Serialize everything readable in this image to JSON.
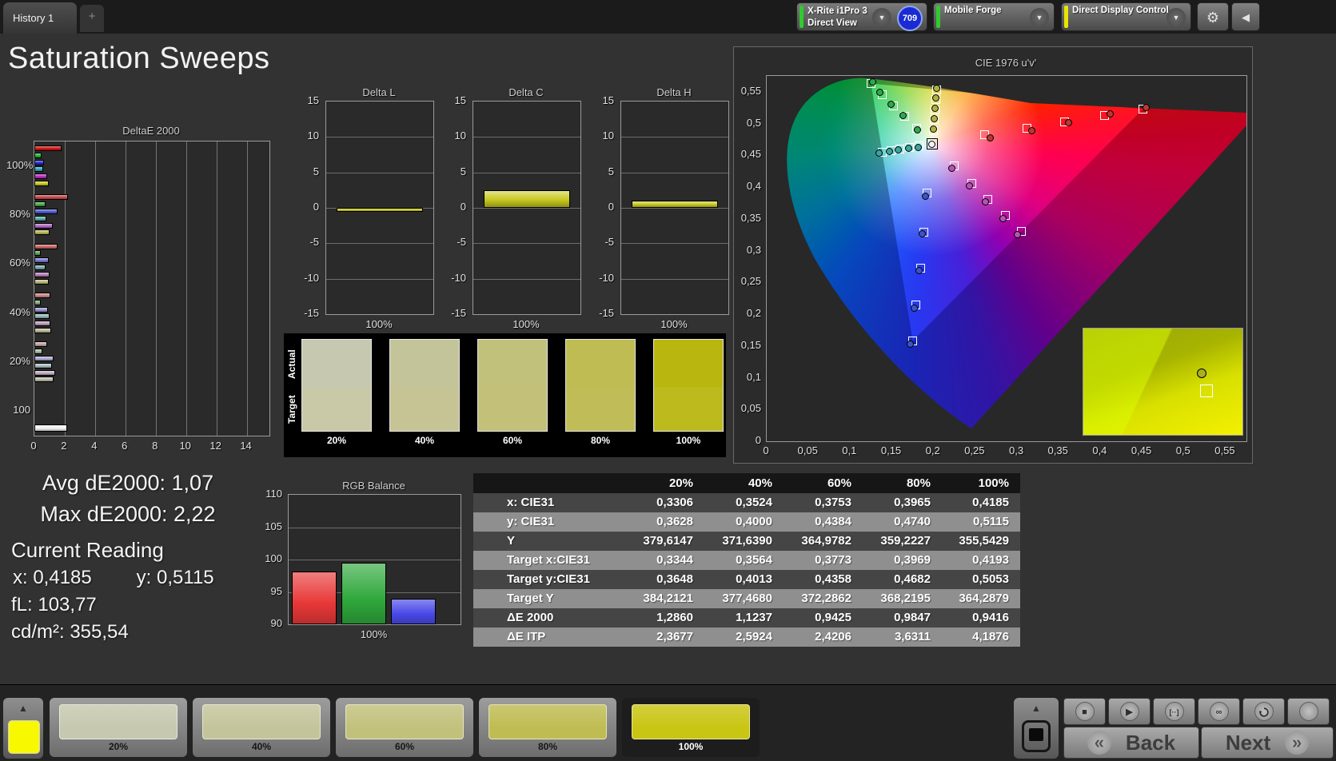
{
  "topbar": {
    "tab": "History 1",
    "add_tab": "+",
    "meter": {
      "line1": "X-Rite i1Pro 3",
      "line2": "Direct View",
      "stripe": "#2ecc2e"
    },
    "badge": "709",
    "source": {
      "label": "Mobile Forge",
      "stripe": "#2ecc2e"
    },
    "display": {
      "label": "Direct Display Control",
      "stripe": "#e6e600"
    },
    "gear_icon": "⚙",
    "collapse_icon": "◀",
    "chevron_icon": "▼"
  },
  "page": {
    "title": "Saturation Sweeps"
  },
  "stats": {
    "avg": "Avg dE2000: 1,07",
    "max": "Max dE2000: 2,22",
    "current_reading": "Current Reading",
    "x": "x: 0,4185",
    "y": "y: 0,5115",
    "fl": "fL: 103,77",
    "cdm2": "cd/m²: 355,54"
  },
  "chart_data": [
    {
      "id": "deltae2000",
      "type": "bar",
      "orientation": "horizontal",
      "title": "DeltaE 2000",
      "xlim": [
        0,
        15.5
      ],
      "xticks": [
        0,
        2,
        4,
        6,
        8,
        10,
        12,
        14
      ],
      "groups": [
        {
          "label": "100%",
          "values": [
            1.8,
            0.5,
            0.65,
            0.6,
            0.85,
            0.94
          ],
          "colors": [
            "#d41414",
            "#18b830",
            "#2828dd",
            "#28a8c8",
            "#c02cc0",
            "#c8c81e"
          ]
        },
        {
          "label": "80%",
          "values": [
            2.22,
            0.72,
            1.55,
            0.78,
            1.2,
            0.98
          ],
          "colors": [
            "#c84848",
            "#44aa44",
            "#4c5ad0",
            "#55aaaa",
            "#b368c4",
            "#b9b95a"
          ]
        },
        {
          "label": "60%",
          "values": [
            1.55,
            0.4,
            0.95,
            0.75,
            1.0,
            0.94
          ],
          "colors": [
            "#c86464",
            "#58a858",
            "#7878d0",
            "#74a8a8",
            "#b87cb8",
            "#b8b878"
          ]
        },
        {
          "label": "40%",
          "values": [
            1.05,
            0.42,
            0.9,
            1.0,
            1.05,
            1.12
          ],
          "colors": [
            "#c88484",
            "#84ac7c",
            "#9494d0",
            "#94b4b4",
            "#bc9cbc",
            "#b8b894"
          ]
        },
        {
          "label": "20%",
          "values": [
            0.85,
            0.55,
            1.28,
            1.15,
            1.35,
            1.29
          ],
          "colors": [
            "#c4a4a4",
            "#a4bca0",
            "#a8a8d4",
            "#a8bcbc",
            "#c0acc0",
            "#bcbca8"
          ]
        },
        {
          "label": "100",
          "values": [
            2.17
          ],
          "colors": [
            "#f0f0f0"
          ]
        }
      ]
    },
    {
      "id": "delta_l",
      "type": "bar",
      "title": "Delta L",
      "ylim": [
        -15,
        15
      ],
      "yticks": [
        15,
        10,
        5,
        0,
        -5,
        -10,
        -15
      ],
      "categories": [
        "100%"
      ],
      "values": [
        -0.6
      ],
      "bar_color": "#c8c81e"
    },
    {
      "id": "delta_c",
      "type": "bar",
      "title": "Delta C",
      "ylim": [
        -15,
        15
      ],
      "yticks": [
        15,
        10,
        5,
        0,
        -5,
        -10,
        -15
      ],
      "categories": [
        "100%"
      ],
      "values": [
        2.5
      ],
      "bar_color": "#c8c81e"
    },
    {
      "id": "delta_h",
      "type": "bar",
      "title": "Delta H",
      "ylim": [
        -15,
        15
      ],
      "yticks": [
        15,
        10,
        5,
        0,
        -5,
        -10,
        -15
      ],
      "categories": [
        "100%"
      ],
      "values": [
        1.0
      ],
      "bar_color": "#c8c81e"
    },
    {
      "id": "cie",
      "type": "scatter",
      "title": "CIE 1976 u'v'",
      "xlim": [
        0,
        0.575
      ],
      "ylim": [
        0,
        0.575
      ],
      "xticks": [
        0,
        0.05,
        0.1,
        0.15,
        0.2,
        0.25,
        0.3,
        0.35,
        0.4,
        0.45,
        0.5,
        0.55
      ],
      "xtick_labels": [
        "0",
        "0,05",
        "0,1",
        "0,15",
        "0,2",
        "0,25",
        "0,3",
        "0,35",
        "0,4",
        "0,45",
        "0,5",
        "0,55"
      ],
      "ytick_labels": [
        "0,55",
        "0,5",
        "0,45",
        "0,4",
        "0,35",
        "0,3",
        "0,25",
        "0,2",
        "0,15",
        "0,1",
        "0,05",
        "0"
      ],
      "yticks": [
        0.55,
        0.5,
        0.45,
        0.4,
        0.35,
        0.3,
        0.25,
        0.2,
        0.15,
        0.1,
        0.05,
        0
      ],
      "white_point": {
        "u": 0.198,
        "v": 0.468
      },
      "series": [
        {
          "name": "red",
          "color": "#b73a32",
          "targets": [
            [
              0.261,
              0.482
            ],
            [
              0.312,
              0.493
            ],
            [
              0.357,
              0.503
            ],
            [
              0.405,
              0.513
            ],
            [
              0.451,
              0.523
            ]
          ],
          "measured": [
            [
              0.268,
              0.478
            ],
            [
              0.318,
              0.489
            ],
            [
              0.362,
              0.501
            ],
            [
              0.412,
              0.515
            ],
            [
              0.455,
              0.525
            ]
          ]
        },
        {
          "name": "green",
          "color": "#2ea84e",
          "targets": [
            [
              0.18,
              0.492
            ],
            [
              0.165,
              0.511
            ],
            [
              0.152,
              0.528
            ],
            [
              0.138,
              0.546
            ],
            [
              0.125,
              0.563
            ]
          ],
          "measured": [
            [
              0.181,
              0.49
            ],
            [
              0.163,
              0.513
            ],
            [
              0.149,
              0.53
            ],
            [
              0.136,
              0.549
            ],
            [
              0.127,
              0.565
            ]
          ]
        },
        {
          "name": "blue",
          "color": "#3a55c8",
          "targets": [
            [
              0.192,
              0.391
            ],
            [
              0.188,
              0.329
            ],
            [
              0.184,
              0.273
            ],
            [
              0.179,
              0.214
            ],
            [
              0.175,
              0.158
            ]
          ],
          "measured": [
            [
              0.19,
              0.386
            ],
            [
              0.186,
              0.326
            ],
            [
              0.183,
              0.268
            ],
            [
              0.177,
              0.21
            ],
            [
              0.172,
              0.153
            ]
          ]
        },
        {
          "name": "cyan",
          "color": "#37a7a0",
          "targets": [
            [
              0.183,
              0.465
            ],
            [
              0.171,
              0.462
            ],
            [
              0.16,
              0.46
            ],
            [
              0.149,
              0.457
            ],
            [
              0.138,
              0.455
            ]
          ],
          "measured": [
            [
              0.182,
              0.463
            ],
            [
              0.17,
              0.461
            ],
            [
              0.158,
              0.459
            ],
            [
              0.147,
              0.456
            ],
            [
              0.135,
              0.453
            ]
          ]
        },
        {
          "name": "magenta",
          "color": "#b455b0",
          "targets": [
            [
              0.225,
              0.434
            ],
            [
              0.246,
              0.406
            ],
            [
              0.265,
              0.381
            ],
            [
              0.286,
              0.355
            ],
            [
              0.305,
              0.33
            ]
          ],
          "measured": [
            [
              0.222,
              0.43
            ],
            [
              0.243,
              0.402
            ],
            [
              0.262,
              0.377
            ],
            [
              0.283,
              0.35
            ],
            [
              0.3,
              0.325
            ]
          ]
        },
        {
          "name": "yellow",
          "color": "#b0b040",
          "targets": [
            [
              0.2,
              0.489
            ],
            [
              0.201,
              0.506
            ],
            [
              0.202,
              0.522
            ],
            [
              0.203,
              0.538
            ],
            [
              0.204,
              0.553
            ]
          ],
          "measured": [
            [
              0.2,
              0.491
            ],
            [
              0.201,
              0.508
            ],
            [
              0.202,
              0.524
            ],
            [
              0.203,
              0.54
            ],
            [
              0.204,
              0.555
            ]
          ]
        }
      ],
      "inset": {
        "point_color": "#a8b020"
      }
    },
    {
      "id": "rgb_balance",
      "type": "bar",
      "title": "RGB Balance",
      "ylim": [
        90,
        110
      ],
      "yticks": [
        110,
        105,
        100,
        95,
        90
      ],
      "categories": [
        "100%"
      ],
      "xlabel": "100%",
      "series": [
        {
          "name": "Red",
          "value": 98.2,
          "color": "#e83838"
        },
        {
          "name": "Green",
          "value": 99.5,
          "color": "#2fa83c"
        },
        {
          "name": "Blue",
          "value": 94.0,
          "color": "#4848e8"
        }
      ]
    }
  ],
  "delta_xlabel": "100%",
  "swatch_compare": {
    "row_labels": [
      "Actual",
      "Target"
    ],
    "levels": [
      "20%",
      "40%",
      "60%",
      "80%",
      "100%"
    ],
    "actual": [
      "#c6c8af",
      "#c4c49b",
      "#c2c17c",
      "#bfbc53",
      "#b9b60f"
    ],
    "target": [
      "#c9c8a7",
      "#c6c394",
      "#c3c079",
      "#c0bd58",
      "#bdba1e"
    ]
  },
  "table": {
    "headers": [
      "",
      "20%",
      "40%",
      "60%",
      "80%",
      "100%"
    ],
    "rows": [
      {
        "label": "x: CIE31",
        "values": [
          "0,3306",
          "0,3524",
          "0,3753",
          "0,3965",
          "0,4185"
        ]
      },
      {
        "label": "y: CIE31",
        "values": [
          "0,3628",
          "0,4000",
          "0,4384",
          "0,4740",
          "0,5115"
        ]
      },
      {
        "label": "Y",
        "values": [
          "379,6147",
          "371,6390",
          "364,9782",
          "359,2227",
          "355,5429"
        ]
      },
      {
        "label": "Target x:CIE31",
        "values": [
          "0,3344",
          "0,3564",
          "0,3773",
          "0,3969",
          "0,4193"
        ]
      },
      {
        "label": "Target y:CIE31",
        "values": [
          "0,3648",
          "0,4013",
          "0,4358",
          "0,4682",
          "0,5053"
        ]
      },
      {
        "label": "Target Y",
        "values": [
          "384,2121",
          "377,4680",
          "372,2862",
          "368,2195",
          "364,2879"
        ]
      },
      {
        "label": "ΔE 2000",
        "values": [
          "1,2860",
          "1,1237",
          "0,9425",
          "0,9847",
          "0,9416"
        ]
      },
      {
        "label": "ΔE ITP",
        "values": [
          "2,3677",
          "2,5924",
          "2,4206",
          "3,6311",
          "4,1876"
        ]
      }
    ]
  },
  "bottom_bar": {
    "patch_color": "#f8f800",
    "up_arrow": "▲",
    "tiles": [
      {
        "label": "20%",
        "color": "#c6c8af",
        "selected": false
      },
      {
        "label": "40%",
        "color": "#c4c49b",
        "selected": false
      },
      {
        "label": "60%",
        "color": "#c2c17c",
        "selected": false
      },
      {
        "label": "80%",
        "color": "#bfbc53",
        "selected": false
      },
      {
        "label": "100%",
        "color": "#c9c513",
        "selected": true
      }
    ],
    "transport": [
      {
        "name": "stop",
        "glyph": "■"
      },
      {
        "name": "play",
        "glyph": "▶"
      },
      {
        "name": "single-measure",
        "glyph": "[··]"
      },
      {
        "name": "continuous",
        "glyph": "∞"
      },
      {
        "name": "refresh",
        "glyph": "svg-refresh"
      },
      {
        "name": "extra",
        "glyph": ""
      }
    ],
    "back": {
      "chev": "«",
      "label": "Back"
    },
    "next": {
      "label": "Next",
      "chev": "»"
    }
  }
}
